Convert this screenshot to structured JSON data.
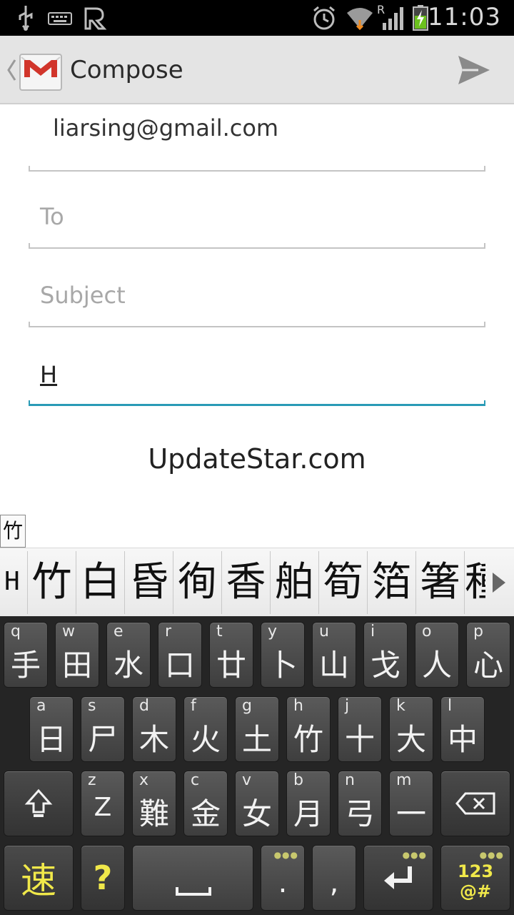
{
  "status_bar": {
    "time": "11:03",
    "icons": [
      "usb-icon",
      "keyboard-icon",
      "app-r-icon",
      "alarm-icon",
      "wifi-icon",
      "signal-icon",
      "battery-charging-icon"
    ],
    "roaming": "R"
  },
  "action_bar": {
    "title": "Compose",
    "app_icon": "gmail-icon",
    "send_icon": "send-icon"
  },
  "form": {
    "from": "liarsing@gmail.com",
    "to_placeholder": "To",
    "subject_placeholder": "Subject",
    "body_value": "H"
  },
  "watermark": "UpdateStar.com",
  "composing_chip": "竹",
  "candidates": {
    "typed": "H",
    "items": [
      "竹",
      "白",
      "昏",
      "徇",
      "香",
      "舶",
      "筍",
      "箔",
      "箸",
      "種"
    ]
  },
  "keyboard": {
    "row1": [
      {
        "hint": "q",
        "main": "手"
      },
      {
        "hint": "w",
        "main": "田"
      },
      {
        "hint": "e",
        "main": "水"
      },
      {
        "hint": "r",
        "main": "口"
      },
      {
        "hint": "t",
        "main": "廿"
      },
      {
        "hint": "y",
        "main": "卜"
      },
      {
        "hint": "u",
        "main": "山"
      },
      {
        "hint": "i",
        "main": "戈"
      },
      {
        "hint": "o",
        "main": "人"
      },
      {
        "hint": "p",
        "main": "心"
      }
    ],
    "row2": [
      {
        "hint": "a",
        "main": "日"
      },
      {
        "hint": "s",
        "main": "尸"
      },
      {
        "hint": "d",
        "main": "木"
      },
      {
        "hint": "f",
        "main": "火"
      },
      {
        "hint": "g",
        "main": "土"
      },
      {
        "hint": "h",
        "main": "竹"
      },
      {
        "hint": "j",
        "main": "十"
      },
      {
        "hint": "k",
        "main": "大"
      },
      {
        "hint": "l",
        "main": "中"
      }
    ],
    "row3": [
      {
        "hint": "z",
        "main": "Z"
      },
      {
        "hint": "x",
        "main": "難"
      },
      {
        "hint": "c",
        "main": "金"
      },
      {
        "hint": "v",
        "main": "女"
      },
      {
        "hint": "b",
        "main": "月"
      },
      {
        "hint": "n",
        "main": "弓"
      },
      {
        "hint": "m",
        "main": "一"
      }
    ],
    "speed_key": "速",
    "question_key": "?",
    "period_key": ".",
    "comma_key": ",",
    "symbols_line1": "123",
    "symbols_line2": "@#",
    "accent_color": "#f0e84a",
    "focus_color": "#2a9bb6"
  }
}
